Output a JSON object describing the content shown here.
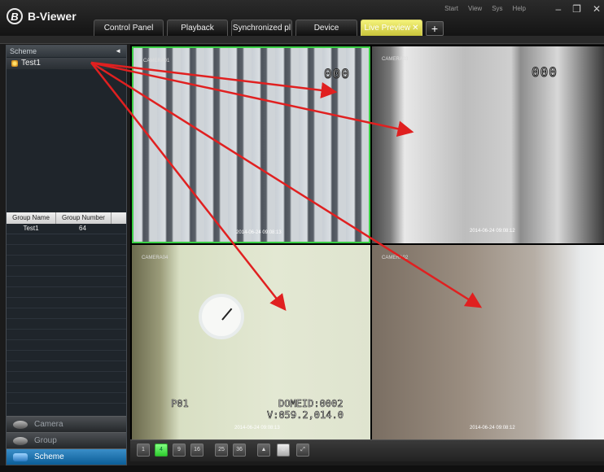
{
  "app": {
    "title": "B-Viewer",
    "logo_glyph": "B"
  },
  "tabs": [
    {
      "label": "Control Panel"
    },
    {
      "label": "Playback"
    },
    {
      "label": "Synchronized pl"
    },
    {
      "label": "Device"
    },
    {
      "label": "Live Preview",
      "active": true
    }
  ],
  "add_tab_label": "+",
  "top_menu": [
    "Start",
    "View",
    "Sys",
    "Help"
  ],
  "window_controls": {
    "minimize": "–",
    "restore": "❐",
    "close": "✕"
  },
  "sidebar": {
    "scheme_header": "Scheme",
    "collapse_glyph": "◄",
    "tree_items": [
      "Test1"
    ],
    "group_table": {
      "columns": [
        "Group Name",
        "Group Number"
      ],
      "rows": [
        {
          "name": "Test1",
          "number": "64"
        }
      ]
    },
    "nav": [
      {
        "label": "Camera",
        "icon": "camera-icon"
      },
      {
        "label": "Group",
        "icon": "group-icon"
      },
      {
        "label": "Scheme",
        "icon": "scheme-icon",
        "active": true
      }
    ]
  },
  "cameras": [
    {
      "label": "CAMERA01",
      "osd": "000",
      "timestamp": "2014-06-24 09:08:13"
    },
    {
      "label": "CAMERA03",
      "osd": "000",
      "timestamp": "2014-06-24 09:08:12"
    },
    {
      "label": "CAMERA04",
      "osd_left": "P01",
      "osd_right_1": "DOMEID:0002",
      "osd_right_2": "V:059.2,014.0",
      "timestamp": "2014-06-24 09:08:13"
    },
    {
      "label": "CAMERA02",
      "timestamp": "2014-06-24 09:08:12"
    }
  ],
  "toolbar": {
    "layout_buttons": [
      "1",
      "4",
      "9",
      "16",
      "25",
      "36"
    ],
    "active_layout": "4"
  },
  "colors": {
    "active_tab": "#e2dd4f",
    "active_border": "#3bcf46",
    "arrow": "#e02020",
    "nav_active": "#1f78b8"
  }
}
